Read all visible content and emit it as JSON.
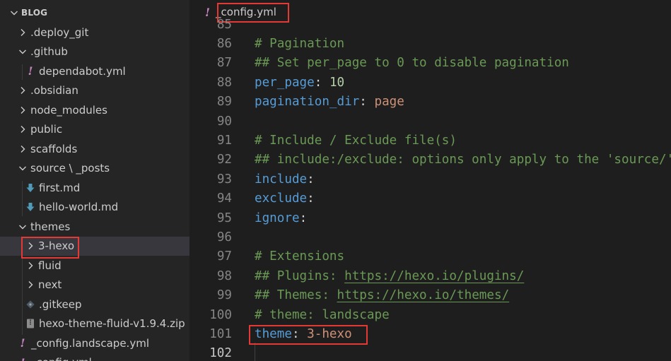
{
  "explorer": {
    "title": "BLOG",
    "items": [
      {
        "label": ".deploy_git",
        "kind": "folder",
        "expanded": false,
        "depth": 1
      },
      {
        "label": ".github",
        "kind": "folder",
        "expanded": true,
        "depth": 1
      },
      {
        "label": "dependabot.yml",
        "kind": "yaml",
        "depth": 2
      },
      {
        "label": ".obsidian",
        "kind": "folder",
        "expanded": false,
        "depth": 1
      },
      {
        "label": "node_modules",
        "kind": "folder",
        "expanded": false,
        "depth": 1
      },
      {
        "label": "public",
        "kind": "folder",
        "expanded": false,
        "depth": 1
      },
      {
        "label": "scaffolds",
        "kind": "folder",
        "expanded": false,
        "depth": 1
      },
      {
        "label": "source \\ _posts",
        "kind": "folder",
        "expanded": true,
        "depth": 1
      },
      {
        "label": "first.md",
        "kind": "markdown",
        "depth": 2
      },
      {
        "label": "hello-world.md",
        "kind": "markdown",
        "depth": 2
      },
      {
        "label": "themes",
        "kind": "folder",
        "expanded": true,
        "depth": 1
      },
      {
        "label": "3-hexo",
        "kind": "folder",
        "expanded": false,
        "depth": 2,
        "selected": true
      },
      {
        "label": "fluid",
        "kind": "folder",
        "expanded": false,
        "depth": 2
      },
      {
        "label": "next",
        "kind": "folder",
        "expanded": false,
        "depth": 2
      },
      {
        "label": ".gitkeep",
        "kind": "gitkeep",
        "depth": 2
      },
      {
        "label": "hexo-theme-fluid-v1.9.4.zip",
        "kind": "zip",
        "depth": 2
      },
      {
        "label": "_config.landscape.yml",
        "kind": "yaml",
        "depth": 1
      },
      {
        "label": "_config.yml",
        "kind": "yaml",
        "depth": 1
      }
    ]
  },
  "editor": {
    "tab": {
      "label": "_config.yml"
    },
    "lines": [
      {
        "n": "85",
        "tokens": []
      },
      {
        "n": "86",
        "tokens": [
          {
            "t": "# Pagination",
            "c": "c"
          }
        ]
      },
      {
        "n": "87",
        "tokens": [
          {
            "t": "## Set per_page to 0 to disable pagination",
            "c": "c"
          }
        ]
      },
      {
        "n": "88",
        "tokens": [
          {
            "t": "per_page",
            "c": "k"
          },
          {
            "t": ": ",
            "c": "p"
          },
          {
            "t": "10",
            "c": "n"
          }
        ]
      },
      {
        "n": "89",
        "tokens": [
          {
            "t": "pagination_dir",
            "c": "k"
          },
          {
            "t": ": ",
            "c": "p"
          },
          {
            "t": "page",
            "c": "s"
          }
        ]
      },
      {
        "n": "90",
        "tokens": []
      },
      {
        "n": "91",
        "tokens": [
          {
            "t": "# Include / Exclude file(s)",
            "c": "c"
          }
        ]
      },
      {
        "n": "92",
        "tokens": [
          {
            "t": "## include:/exclude: options only apply to the 'source/' folder",
            "c": "c"
          }
        ]
      },
      {
        "n": "93",
        "tokens": [
          {
            "t": "include",
            "c": "k"
          },
          {
            "t": ":",
            "c": "p"
          }
        ]
      },
      {
        "n": "94",
        "tokens": [
          {
            "t": "exclude",
            "c": "k"
          },
          {
            "t": ":",
            "c": "p"
          }
        ]
      },
      {
        "n": "95",
        "tokens": [
          {
            "t": "ignore",
            "c": "k"
          },
          {
            "t": ":",
            "c": "p"
          }
        ]
      },
      {
        "n": "96",
        "tokens": []
      },
      {
        "n": "97",
        "tokens": [
          {
            "t": "# Extensions",
            "c": "c"
          }
        ]
      },
      {
        "n": "98",
        "tokens": [
          {
            "t": "## Plugins: ",
            "c": "c"
          },
          {
            "t": "https://hexo.io/plugins/",
            "c": "u"
          }
        ]
      },
      {
        "n": "99",
        "tokens": [
          {
            "t": "## Themes: ",
            "c": "c"
          },
          {
            "t": "https://hexo.io/themes/",
            "c": "u"
          }
        ]
      },
      {
        "n": "100",
        "tokens": [
          {
            "t": "# theme: landscape",
            "c": "c"
          }
        ]
      },
      {
        "n": "101",
        "tokens": [
          {
            "t": "theme",
            "c": "k"
          },
          {
            "t": ": ",
            "c": "p"
          },
          {
            "t": "3-hexo",
            "c": "s"
          }
        ]
      },
      {
        "n": "102",
        "tokens": [],
        "active": true
      }
    ]
  },
  "colors": {
    "highlight": "#e53935",
    "comment": "#6a9955",
    "key": "#569cd6",
    "string": "#ce9178",
    "number": "#b5cea8"
  }
}
